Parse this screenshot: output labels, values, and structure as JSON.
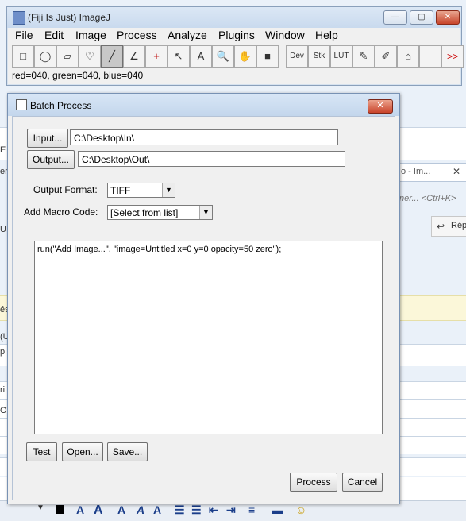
{
  "background": {
    "left_fragments": [
      "E",
      "er",
      "U",
      "és",
      "(U",
      "p",
      "ri",
      "OV"
    ],
    "tab_label": "o - Im...",
    "tab_close": "✕",
    "search_hint": "ner... <Ctrl+K>",
    "reply_label": "Rép"
  },
  "imagej": {
    "title": "(Fiji Is Just) ImageJ",
    "menu": [
      "File",
      "Edit",
      "Image",
      "Process",
      "Analyze",
      "Plugins",
      "Window",
      "Help"
    ],
    "tools": [
      "□",
      "◯",
      "▱",
      "♡",
      "╱",
      "∠",
      "+",
      "↖",
      "A",
      "🔍",
      "✋",
      "■",
      "Dev",
      "Stk",
      "LUT",
      "✎",
      "✐",
      "⌂",
      ">>"
    ],
    "status": "red=040, green=040, blue=040",
    "window_buttons": {
      "minimize": "—",
      "maximize": "▢",
      "close": "✕"
    }
  },
  "dialog": {
    "title": "Batch Process",
    "close": "✕",
    "input_button": "Input...",
    "input_path": "C:\\Desktop\\In\\",
    "output_button": "Output...",
    "output_path": "C:\\Desktop\\Out\\",
    "output_format_label": "Output Format:",
    "output_format_value": "TIFF",
    "macro_label": "Add Macro Code:",
    "macro_value": "[Select from list]",
    "macro_code": "run(\"Add Image...\", \"image=Untitled x=0 y=0 opacity=50 zero\");",
    "test_button": "Test",
    "open_button": "Open...",
    "save_button": "Save...",
    "process_button": "Process",
    "cancel_button": "Cancel"
  },
  "colors": {
    "titlebar": "#c9daee",
    "close_red": "#c9432a",
    "dialog_bg": "#f0f0f0"
  }
}
